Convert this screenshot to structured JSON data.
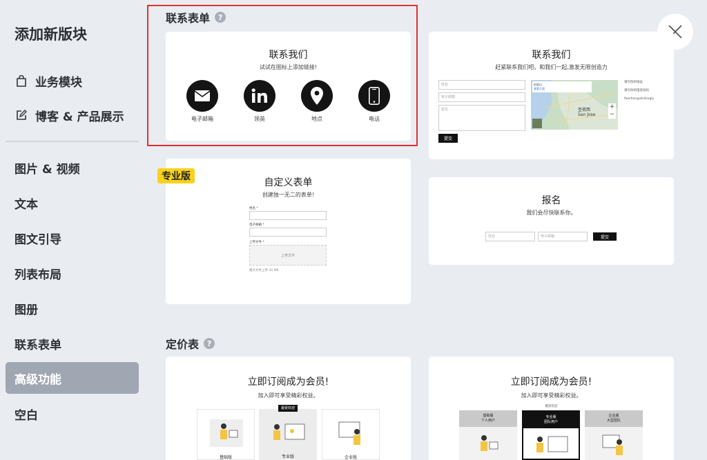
{
  "sidebar": {
    "title": "添加新版块",
    "items": [
      {
        "label": "业务模块",
        "icon": "bag-icon"
      },
      {
        "label": "博客 & 产品展示",
        "icon": "edit-icon"
      },
      {
        "label": "图片 & 视频"
      },
      {
        "label": "文本"
      },
      {
        "label": "图文引导"
      },
      {
        "label": "列表布局"
      },
      {
        "label": "图册"
      },
      {
        "label": "联系表单"
      },
      {
        "label": "高级功能"
      },
      {
        "label": "空白"
      }
    ]
  },
  "contact_section": {
    "title": "联系表单",
    "card1": {
      "heading": "联系我们",
      "sub": "试试在图标上添加链接!",
      "items": [
        {
          "label": "电子邮箱",
          "icon": "mail-icon"
        },
        {
          "label": "领英",
          "icon": "linkedin-icon"
        },
        {
          "label": "地点",
          "icon": "location-pin-icon"
        },
        {
          "label": "电话",
          "icon": "phone-icon"
        }
      ]
    },
    "card2": {
      "heading": "联系我们",
      "sub": "赶紧联系我们吧。和我们一起,激发无限创造力",
      "name_ph": "姓名",
      "email_ph": "电子邮箱",
      "msg_ph": "留言",
      "submit": "提交",
      "map_popup_title": "旧金山",
      "map_popup_link": "查看大图",
      "map_city": "圣荷西",
      "map_city_en": "San Jose",
      "info": [
        "请写你的地址",
        "请写你的电话号码",
        "feechen@strikingly"
      ]
    },
    "card3": {
      "badge": "专业版",
      "heading": "自定义表单",
      "sub": "创建独一无二的表单!",
      "field1": "姓名 *",
      "field2": "电子邮箱 *",
      "field3": "上传文件 *",
      "upload": "上传文件",
      "note": "最大文件上传 20 MB"
    },
    "card4": {
      "heading": "报名",
      "sub": "我们会尽快联系你。",
      "name_ph": "姓名",
      "email_ph": "电子邮箱",
      "submit": "提交"
    }
  },
  "pricing_section": {
    "title": "定价表",
    "card1": {
      "heading": "立即订阅成为会员!",
      "sub": "加入即可享受精彩权益。",
      "popular": "最受欢迎",
      "tiers": [
        "基础版",
        "专业版",
        "企业版"
      ]
    },
    "card2": {
      "heading": "立即订阅成为会员!",
      "sub": "加入即可享受精彩权益。",
      "popular": "最受欢迎",
      "tiers": [
        {
          "name": "基础版",
          "desc": "个人用户"
        },
        {
          "name": "专业版",
          "desc": "团队用户"
        },
        {
          "name": "企业版",
          "desc": "大型团队"
        }
      ]
    }
  },
  "colors": {
    "highlight": "#e4302b",
    "active_bg": "#a0a7b2",
    "badge": "#f8d21c"
  }
}
